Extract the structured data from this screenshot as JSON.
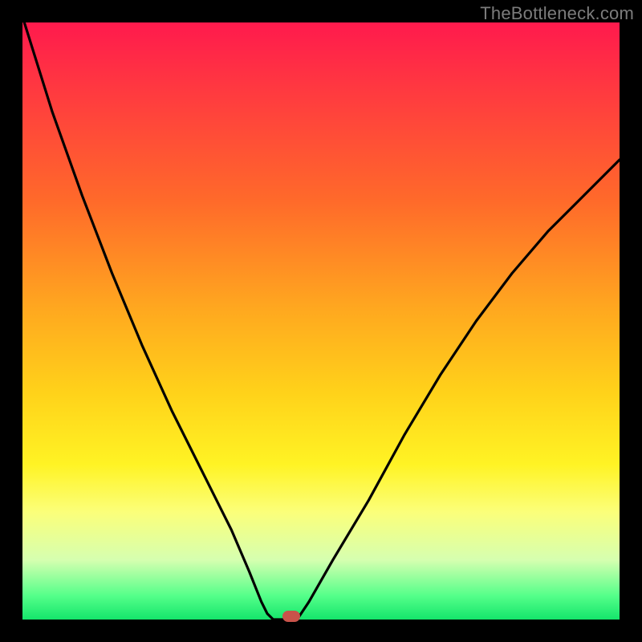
{
  "watermark": "TheBottleneck.com",
  "colors": {
    "frame": "#000000",
    "curve": "#000000",
    "marker": "#c9534a",
    "gradient_stops": [
      "#ff1a4d",
      "#ff3b3f",
      "#ff6a2a",
      "#ffa81f",
      "#ffd21a",
      "#fff324",
      "#fbff7a",
      "#d6ffb0",
      "#55ff8a",
      "#14e56b"
    ]
  },
  "chart_data": {
    "type": "line",
    "title": "",
    "xlabel": "",
    "ylabel": "",
    "xlim": [
      0,
      100
    ],
    "ylim": [
      0,
      100
    ],
    "grid": false,
    "legend": false,
    "series": [
      {
        "name": "left-branch",
        "x": [
          0,
          5,
          10,
          15,
          20,
          25,
          30,
          35,
          38,
          40,
          41,
          42
        ],
        "y": [
          101,
          85,
          71,
          58,
          46,
          35,
          25,
          15,
          8,
          3,
          1,
          0
        ]
      },
      {
        "name": "right-branch",
        "x": [
          46,
          48,
          52,
          58,
          64,
          70,
          76,
          82,
          88,
          94,
          100
        ],
        "y": [
          0,
          3,
          10,
          20,
          31,
          41,
          50,
          58,
          65,
          71,
          77
        ]
      },
      {
        "name": "flat-segment",
        "x": [
          42,
          46
        ],
        "y": [
          0,
          0
        ]
      }
    ],
    "marker": {
      "x": 45,
      "y": 0.5,
      "name": "optimum-marker"
    },
    "axes_visible": false
  }
}
